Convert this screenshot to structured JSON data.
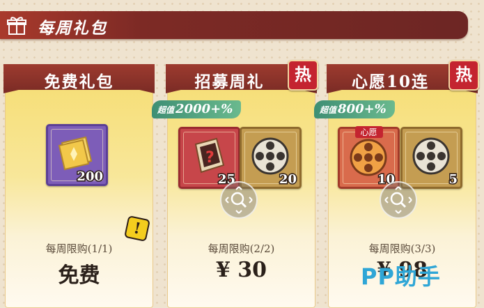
{
  "header": {
    "title": "每周礼包",
    "icon": "gift-icon"
  },
  "cards": [
    {
      "title": "免费礼包",
      "hot": false,
      "badge": null,
      "items": [
        {
          "name": "gold-ticket",
          "qty": "200"
        }
      ],
      "limit": "每周限购(1/1)",
      "price": "免费",
      "alert": "!"
    },
    {
      "title": "招募周礼",
      "hot": true,
      "hot_label": "热",
      "badge": {
        "prefix": "超值",
        "value": "2000+%"
      },
      "items": [
        {
          "name": "mystery-card",
          "qty": "25"
        },
        {
          "name": "film-reel",
          "qty": "20"
        }
      ],
      "limit": "每周限购(2/2)",
      "price": "¥ 30"
    },
    {
      "title": "心愿10连",
      "hot": true,
      "hot_label": "热",
      "badge": {
        "prefix": "超值",
        "value": "800+%"
      },
      "items": [
        {
          "name": "wish-reel",
          "qty": "10",
          "tag": "心愿"
        },
        {
          "name": "film-reel",
          "qty": "5"
        }
      ],
      "limit": "每周限购(3/3)",
      "price": "¥ 98"
    }
  ],
  "watermark": {
    "part1": "PP",
    "part2": "助手"
  }
}
